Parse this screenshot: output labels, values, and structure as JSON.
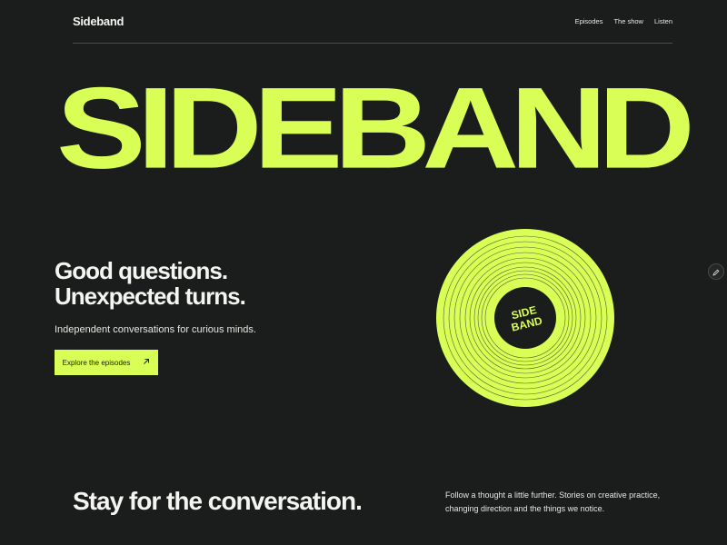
{
  "header": {
    "brand": "Sideband",
    "links": [
      "Episodes",
      "The show",
      "Listen"
    ]
  },
  "hero": {
    "wordmark": "SIDEBAND",
    "headline_lines": [
      "Good questions.",
      "Unexpected turns."
    ],
    "subtitle": "Independent conversations for curious minds.",
    "cta_label": "Explore the episodes",
    "cta_icon": "arrow-up-right-icon"
  },
  "record": {
    "label_lines": [
      "SIDE",
      "BAND"
    ]
  },
  "edit_icon": "pencil-icon",
  "section": {
    "heading": "Stay for the conversation.",
    "description": "Follow a thought a little further. Stories on creative practice, changing direction and the things we notice."
  },
  "colors": {
    "background": "#1a1d1b",
    "accent": "#d9ff57",
    "text": "#f4f4f0",
    "divider": "#4a4d4b"
  }
}
